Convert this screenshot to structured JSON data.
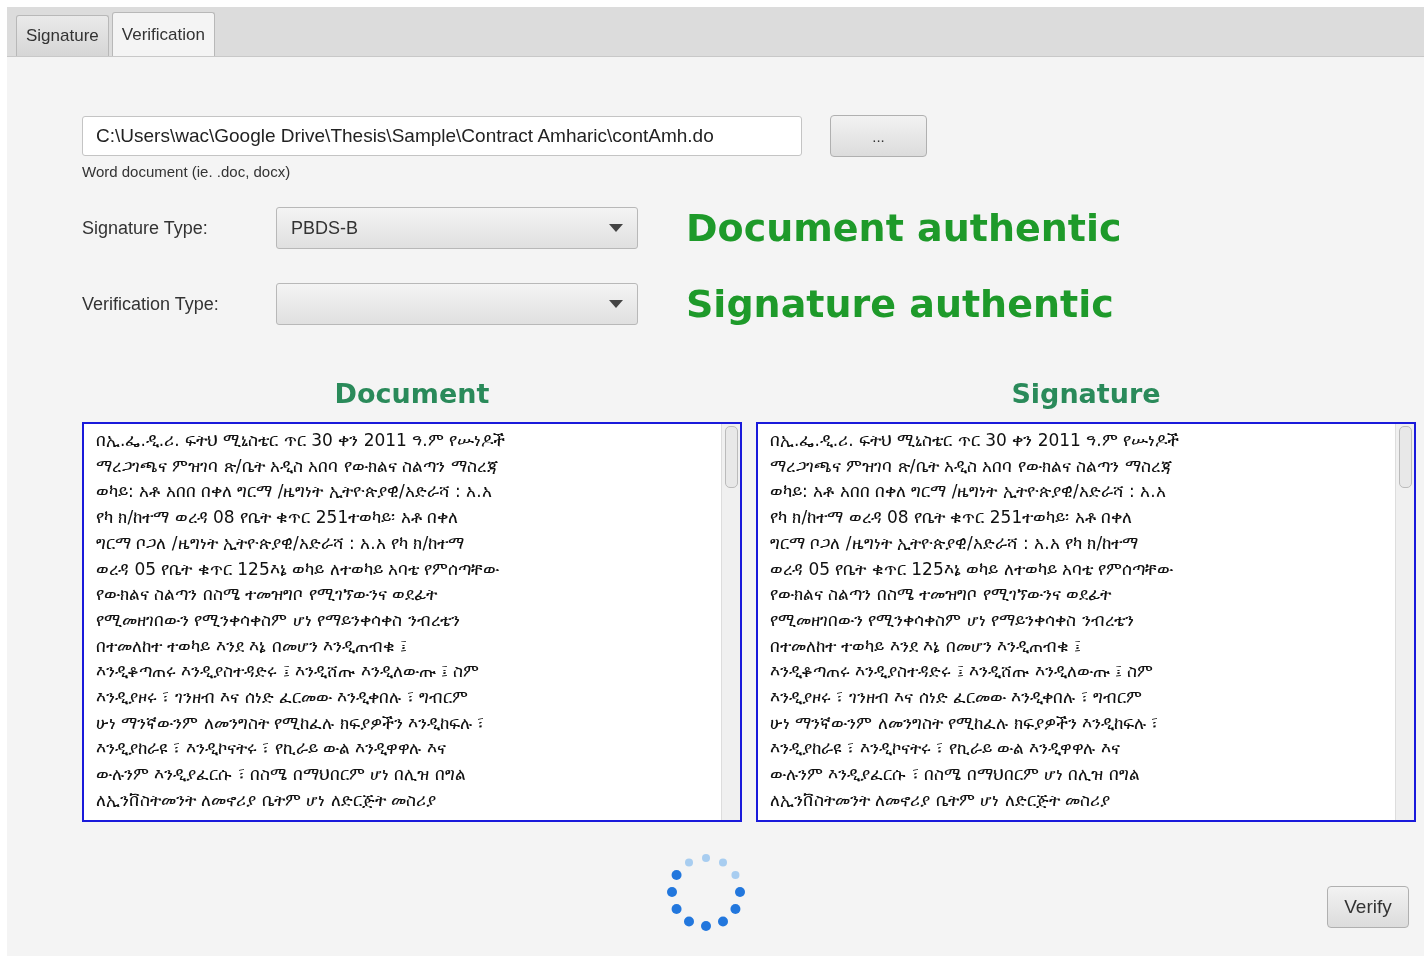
{
  "tabs": [
    {
      "label": "Signature",
      "selected": false
    },
    {
      "label": "Verification",
      "selected": true
    }
  ],
  "file": {
    "value": "C:\\Users\\wac\\Google Drive\\Thesis\\Sample\\Contract Amharic\\contAmh.do",
    "hint": "Word document (ie. .doc, docx)",
    "browse_label": "..."
  },
  "fields": [
    {
      "label": "Signature Type:",
      "value": "PBDS-B",
      "status": "Document authentic"
    },
    {
      "label": "Verification Type:",
      "status": "Signature authentic"
    }
  ],
  "panels": [
    {
      "title": "Document",
      "lines": [
        "በኢ.ፌ.ዲ.ሪ. ፍትህ ሚኒስቴር ጥር 30 ቀን 2011 ዓ.ም የሡነዶች",
        "ማረጋገጫና ምዝገባ ጽ/ቤት አዲስ አበባ የውክልና ስልጣን ማስረጃ",
        "ወካይ: አቶ አበበ በቀለ ግርማ /ዜግነት ኢትዮጵያዊ/አድራሻ : አ.አ",
        "የካ ክ/ከተማ ወረዳ 08 የቤት ቁጥር 251ተወካይ፡ አቶ በቀለ",
        "ግርማ ቦጋለ /ዜግነት ኢትዮጵያዊ/አድራሻ : አ.አ የካ ክ/ከተማ",
        "ወረዳ 05 የቤት ቁጥር 125እኔ ወካይ ለተወካይ አባቴ የምሰጣቸው",
        "የውክልና ስልጣን በስሜ ተመዝግቦ የሚገኘውንና ወደፊት",
        "የሚመዘገበውን የሚንቀሳቀስም ሆነ የማይንቀሳቀስ ንብረቴን",
        "በተመለከተ ተወካይ እንደ እኔ በመሆን እንዲጠብቁ ፤",
        "እንዲቆጣጠሩ እንዲያስተዳድሩ ፤ እንዲሸጡ እንዲለውጡ ፤ ስም",
        "እንዲያዞሩ ፣ ገንዘብ እና ሰነድ ፈርመው እንዲቀበሉ ፣ ግብርም",
        "ሁነ ማንኛውንም ለመንግስት የሚከፈሉ ክፍያዎችን እንዲከፍሉ ፣",
        "እንዲያከራዩ ፣ እንዲኮናትሩ ፣ የኪራይ ውል እንዲዋዋሉ እና",
        "ውሉንም እንዲያፈርሱ ፣ በስሜ በማህበርም ሆነ በሊዝ በግል",
        "ለኢንቨስትመንት ለመኖሪያ ቤትም ሆነ ለድርጅት መስሪያ"
      ]
    },
    {
      "title": "Signature",
      "lines": [
        "በኢ.ፌ.ዲ.ሪ. ፍትህ ሚኒስቴር ጥር 30 ቀን 2011 ዓ.ም የሡነዶች",
        "ማረጋገጫና ምዝገባ ጽ/ቤት አዲስ አበባ የውክልና ስልጣን ማስረጃ",
        "ወካይ: አቶ አበበ በቀለ ግርማ /ዜግነት ኢትዮጵያዊ/አድራሻ : አ.አ",
        "የካ ክ/ከተማ ወረዳ 08 የቤት ቁጥር 251ተወካይ፡ አቶ በቀለ",
        "ግርማ ቦጋለ /ዜግነት ኢትዮጵያዊ/አድራሻ : አ.አ የካ ክ/ከተማ",
        "ወረዳ 05 የቤት ቁጥር 125እኔ ወካይ ለተወካይ አባቴ የምሰጣቸው",
        "የውክልና ስልጣን በስሜ ተመዝግቦ የሚገኘውንና ወደፊት",
        "የሚመዘገበውን የሚንቀሳቀስም ሆነ የማይንቀሳቀስ ንብረቴን",
        "በተመለከተ ተወካይ እንደ እኔ በመሆን እንዲጠብቁ ፤",
        "እንዲቆጣጠሩ እንዲያስተዳድሩ ፤ እንዲሸጡ እንዲለውጡ ፤ ስም",
        "እንዲያዞሩ ፣ ገንዘብ እና ሰነድ ፈርመው እንዲቀበሉ ፣ ግብርም",
        "ሁነ ማንኛውንም ለመንግስት የሚከፈሉ ክፍያዎችን እንዲከፍሉ ፣",
        "እንዲያከራዩ ፣ እንዲኮናትሩ ፣ የኪራይ ውል እንዲዋዋሉ እና",
        "ውሉንም እንዲያፈርሱ ፣ በስሜ በማህበርም ሆነ በሊዝ በግል",
        "ለኢንቨስትመንት ለመኖሪያ ቤትም ሆነ ለድርጅት መስሪያ"
      ]
    }
  ],
  "verify_label": "Verify"
}
